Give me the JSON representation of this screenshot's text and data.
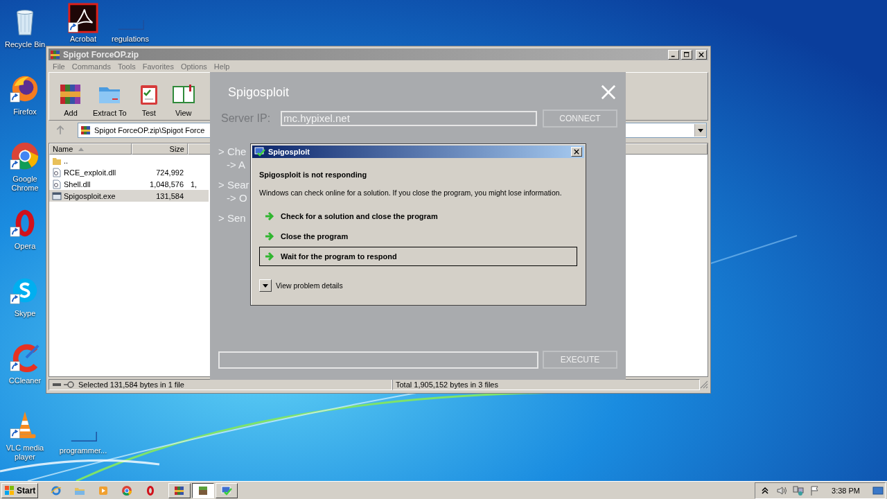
{
  "desktop": {
    "icons": [
      {
        "label": "Recycle Bin",
        "kind": "recycle",
        "shortcut": false
      },
      {
        "label": "Firefox",
        "kind": "firefox",
        "shortcut": true
      },
      {
        "label": "Google Chrome",
        "kind": "chrome",
        "shortcut": true
      },
      {
        "label": "Opera",
        "kind": "opera",
        "shortcut": true
      },
      {
        "label": "Skype",
        "kind": "skype",
        "shortcut": true
      },
      {
        "label": "CCleaner",
        "kind": "ccleaner",
        "shortcut": true
      },
      {
        "label": "VLC media player",
        "kind": "vlc",
        "shortcut": true
      }
    ],
    "other_icons": [
      {
        "label": "Acrobat",
        "kind": "pdf",
        "shortcut": true
      },
      {
        "label": "regulations",
        "kind": "blank",
        "shortcut": false
      },
      {
        "label": "programmer...",
        "kind": "blank",
        "shortcut": false
      }
    ]
  },
  "archiver_window": {
    "title": "Spigot ForceOP.zip",
    "menu": [
      "File",
      "Commands",
      "Tools",
      "Favorites",
      "Options",
      "Help"
    ],
    "toolbar": [
      {
        "label": "Add",
        "kind": "add"
      },
      {
        "label": "Extract To",
        "kind": "extract"
      },
      {
        "label": "Test",
        "kind": "test"
      },
      {
        "label": "View",
        "kind": "view"
      }
    ],
    "path": "Spigot ForceOP.zip\\Spigot Force",
    "columns": [
      "Name",
      "Size"
    ],
    "rows": [
      {
        "name": "..",
        "kind": "folder",
        "selected": false
      },
      {
        "name": "RCE_exploit.dll",
        "kind": "dll",
        "size": "724,992",
        "selected": false
      },
      {
        "name": "Shell.dll",
        "kind": "dll",
        "size": "1,048,576",
        "column_3": "1,",
        "selected": false
      },
      {
        "name": "Spigosploit.exe",
        "kind": "exe",
        "size": "131,584",
        "selected": true
      }
    ],
    "status_left": "Selected 131,584 bytes in 1 file",
    "status_right": "Total 1,905,152 bytes in 3 files"
  },
  "spigosploit": {
    "title": "Spigosploit",
    "server_ip_label": "Server IP:",
    "server_ip": "mc.hypixel.net",
    "connect_button": "CONNECT",
    "log": [
      {
        "line": "> Che",
        "detail": "-> A"
      },
      {
        "line": "> Sear",
        "detail": "-> O"
      },
      {
        "line": "> Sen"
      }
    ],
    "execute_button": "EXECUTE"
  },
  "dialog": {
    "title": "Spigosploit",
    "heading": "Spigosploit is not responding",
    "message": "Windows can check online for a solution. If you close the program, you might lose information.",
    "options": [
      {
        "label": "Check for a solution and close the program",
        "selected": false
      },
      {
        "label": "Close the program",
        "selected": false
      },
      {
        "label": "Wait for the program to respond",
        "selected": true
      }
    ],
    "details": {
      "label": "View problem details",
      "expanded": false
    }
  },
  "taskbar": {
    "start": "Start",
    "quick_launch": [
      {
        "kind": "ie"
      },
      {
        "kind": "folder"
      },
      {
        "kind": "media"
      },
      {
        "kind": "chrome"
      },
      {
        "kind": "opera"
      }
    ],
    "tasks": [
      {
        "kind": "archive",
        "active": false
      },
      {
        "kind": "block",
        "active": true
      },
      {
        "kind": "app",
        "active": false
      }
    ],
    "clock": "3:38 PM"
  }
}
